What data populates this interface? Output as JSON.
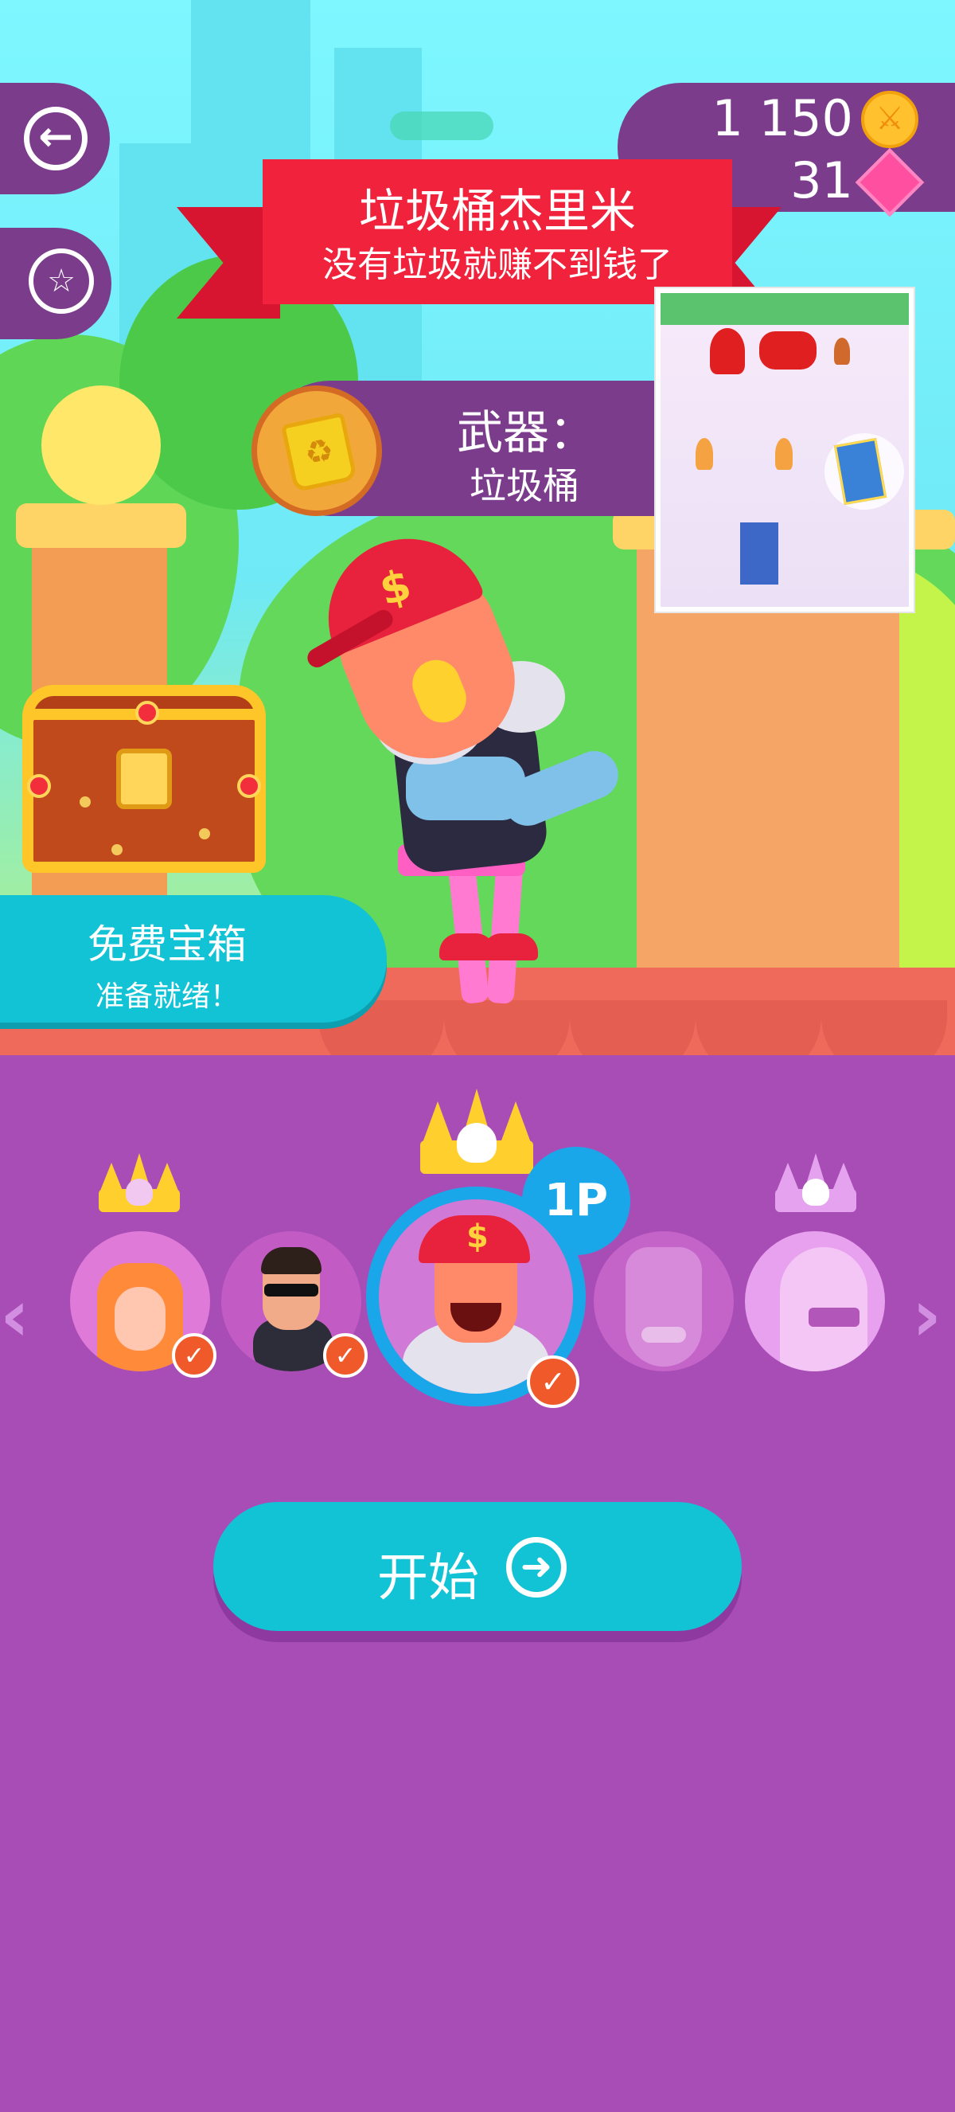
{
  "hud": {
    "coins": "1 150",
    "gems": "31",
    "coin_icon": "coin-icon",
    "gem_icon": "gem-icon",
    "back_icon": "back-arrow-icon",
    "badge_icon": "achievement-badge-icon",
    "badge_glyph": "☆",
    "back_glyph": "←",
    "coin_glyph": "⚔"
  },
  "banner": {
    "title": "垃圾桶杰里米",
    "subtitle": "没有垃圾就赚不到钱了"
  },
  "weapon": {
    "label": "武器：",
    "name": "垃圾桶",
    "bin_glyph": "♻"
  },
  "chest": {
    "title": "免费宝箱",
    "status": "准备就绪！"
  },
  "character_select": {
    "selected_player": "1P",
    "check_glyph": "✓",
    "prev_glyph": "‹",
    "next_glyph": "›"
  },
  "start": {
    "label": "开始",
    "icon_glyph": "➜"
  },
  "colors": {
    "panel_purple": "#7b3c8c",
    "background_purple": "#a94db6",
    "accent_cyan": "#12c3d6",
    "banner_red": "#f0223c",
    "selected_blue": "#1aa7ea"
  }
}
